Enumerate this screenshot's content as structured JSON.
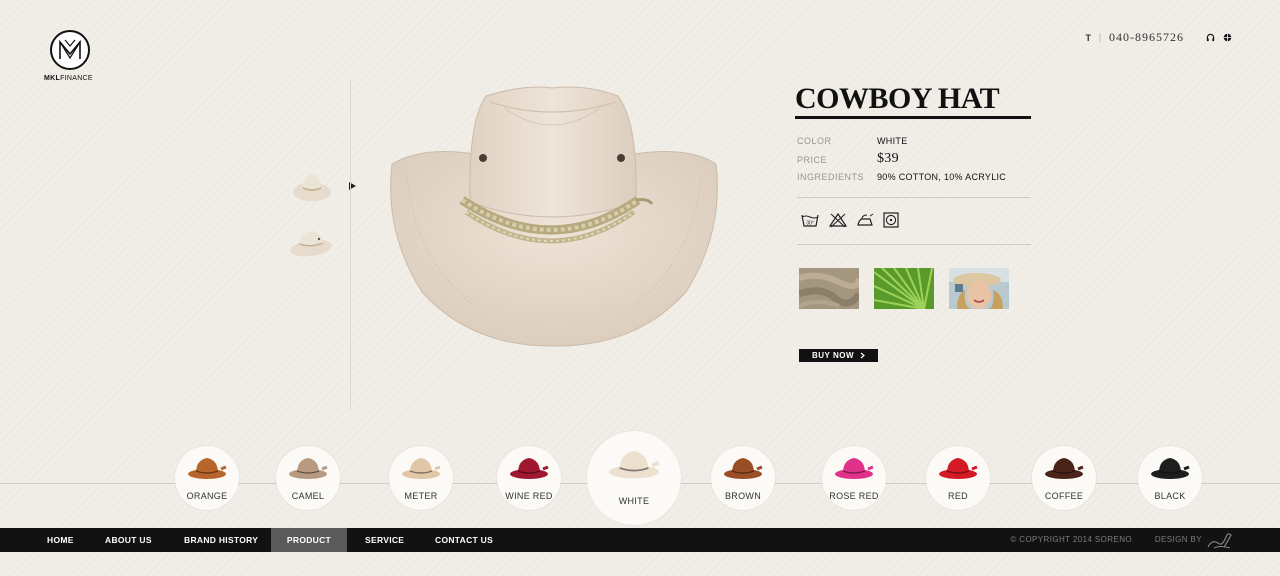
{
  "logo": {
    "text_bold": "MKL",
    "text_rest": "FINANCE"
  },
  "contact": {
    "prefix": "T",
    "separator": "|",
    "phone": "040-8965726",
    "icons": [
      "headset-icon",
      "globe-icon"
    ]
  },
  "product": {
    "title": "COWBOY HAT",
    "specs": {
      "color_label": "COLOR",
      "color_value": "WHITE",
      "price_label": "PRICE",
      "price_value": "$39",
      "ingredients_label": "INGREDIENTS",
      "ingredients_value": "90%  COTTON,  10%  ACRYLIC"
    },
    "care_icons": [
      "wash-30-icon",
      "no-bleach-icon",
      "iron-icon",
      "tumble-dry-icon"
    ],
    "detail_images": [
      "linen-texture-image",
      "palm-leaf-image",
      "model-wearing-hat-image"
    ],
    "buy_label": "BUY  NOW",
    "buy_icon": "chevron-right-icon",
    "thumbnails": [
      "hat-front-thumbnail",
      "hat-side-thumbnail"
    ]
  },
  "colors": [
    {
      "label": "ORANGE",
      "hex": "#b8652c"
    },
    {
      "label": "CAMEL",
      "hex": "#b79a80"
    },
    {
      "label": "METER",
      "hex": "#e2c6a8"
    },
    {
      "label": "WINE  RED",
      "hex": "#a01830"
    },
    {
      "label": "WHITE",
      "hex": "#ede0cf",
      "selected": true
    },
    {
      "label": "BROWN",
      "hex": "#9a4e25"
    },
    {
      "label": "ROSE  RED",
      "hex": "#e0328a"
    },
    {
      "label": "RED",
      "hex": "#d41a25"
    },
    {
      "label": "COFFEE",
      "hex": "#4a2418"
    },
    {
      "label": "BLACK",
      "hex": "#1e1e1e"
    }
  ],
  "nav": {
    "items": [
      "HOME",
      "ABOUT  US",
      "BRAND  HISTORY",
      "PRODUCT",
      "SERVICE",
      "CONTACT  US"
    ],
    "active": "PRODUCT"
  },
  "footer": {
    "copyright": "© COPYRIGHT 2014 SORENO",
    "design_by": "DESIGN BY"
  }
}
